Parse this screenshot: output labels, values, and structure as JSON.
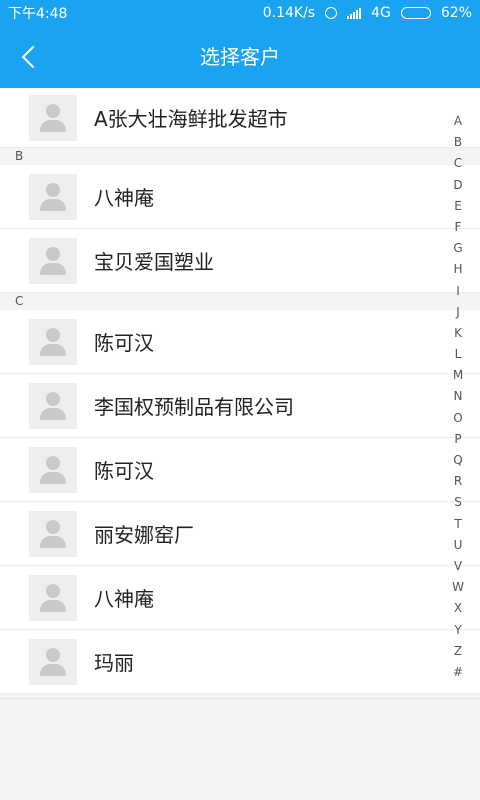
{
  "status": {
    "time": "下午4:48",
    "speed": "0.14K/s",
    "network": "4G",
    "battery": "62%",
    "battery_level": 0.62
  },
  "header": {
    "title": "选择客户",
    "back_icon": "back-arrow-icon"
  },
  "first_item": {
    "name": "A张大壮海鲜批发超市"
  },
  "sections": [
    {
      "letter": "B",
      "items": [
        {
          "name": "八神庵"
        },
        {
          "name": "宝贝爱国塑业"
        }
      ]
    },
    {
      "letter": "C",
      "items": [
        {
          "name": "陈可汉"
        },
        {
          "name": "李国权预制品有限公司"
        },
        {
          "name": "陈可汉"
        },
        {
          "name": "丽安娜窑厂"
        },
        {
          "name": "八神庵"
        },
        {
          "name": "玛丽"
        }
      ]
    }
  ],
  "index_letters": [
    "A",
    "B",
    "C",
    "D",
    "E",
    "F",
    "G",
    "H",
    "I",
    "J",
    "K",
    "L",
    "M",
    "N",
    "O",
    "P",
    "Q",
    "R",
    "S",
    "T",
    "U",
    "V",
    "W",
    "X",
    "Y",
    "Z",
    "#"
  ],
  "colors": {
    "primary": "#1aa3f0"
  }
}
